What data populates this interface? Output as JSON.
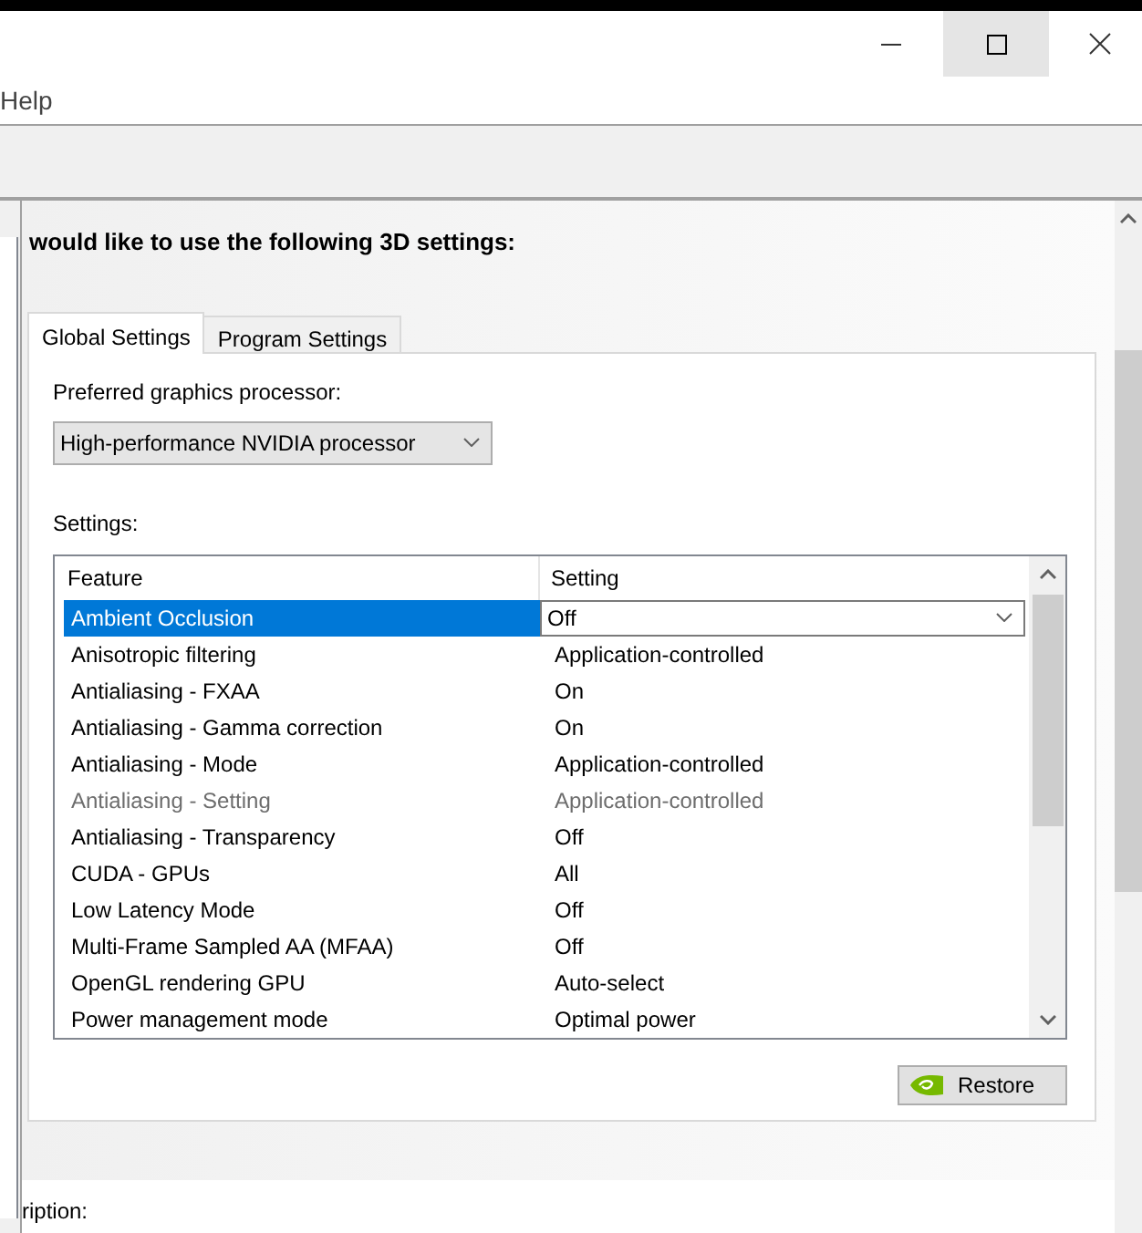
{
  "window": {
    "menu": [
      {
        "label": "Help"
      }
    ]
  },
  "heading": "would like to use the following 3D settings:",
  "tabs": [
    {
      "label": "Global Settings",
      "selected": true
    },
    {
      "label": "Program Settings",
      "selected": false
    }
  ],
  "preferred_gpu": {
    "label": "Preferred graphics processor:",
    "value": "High-performance NVIDIA processor"
  },
  "settings": {
    "label": "Settings:",
    "columns": [
      "Feature",
      "Setting"
    ],
    "rows": [
      {
        "feature": "Ambient Occlusion",
        "setting": "Off",
        "selected": true,
        "disabled": false
      },
      {
        "feature": "Anisotropic filtering",
        "setting": "Application-controlled",
        "selected": false,
        "disabled": false
      },
      {
        "feature": "Antialiasing - FXAA",
        "setting": "On",
        "selected": false,
        "disabled": false
      },
      {
        "feature": "Antialiasing - Gamma correction",
        "setting": "On",
        "selected": false,
        "disabled": false
      },
      {
        "feature": "Antialiasing - Mode",
        "setting": "Application-controlled",
        "selected": false,
        "disabled": false
      },
      {
        "feature": "Antialiasing - Setting",
        "setting": "Application-controlled",
        "selected": false,
        "disabled": true
      },
      {
        "feature": "Antialiasing - Transparency",
        "setting": "Off",
        "selected": false,
        "disabled": false
      },
      {
        "feature": "CUDA - GPUs",
        "setting": "All",
        "selected": false,
        "disabled": false
      },
      {
        "feature": "Low Latency Mode",
        "setting": "Off",
        "selected": false,
        "disabled": false
      },
      {
        "feature": "Multi-Frame Sampled AA (MFAA)",
        "setting": "Off",
        "selected": false,
        "disabled": false
      },
      {
        "feature": "OpenGL rendering GPU",
        "setting": "Auto-select",
        "selected": false,
        "disabled": false
      },
      {
        "feature": "Power management mode",
        "setting": "Optimal power",
        "selected": false,
        "disabled": false
      }
    ]
  },
  "restore_button": {
    "label": "Restore"
  },
  "description": {
    "label": "ription:"
  }
}
